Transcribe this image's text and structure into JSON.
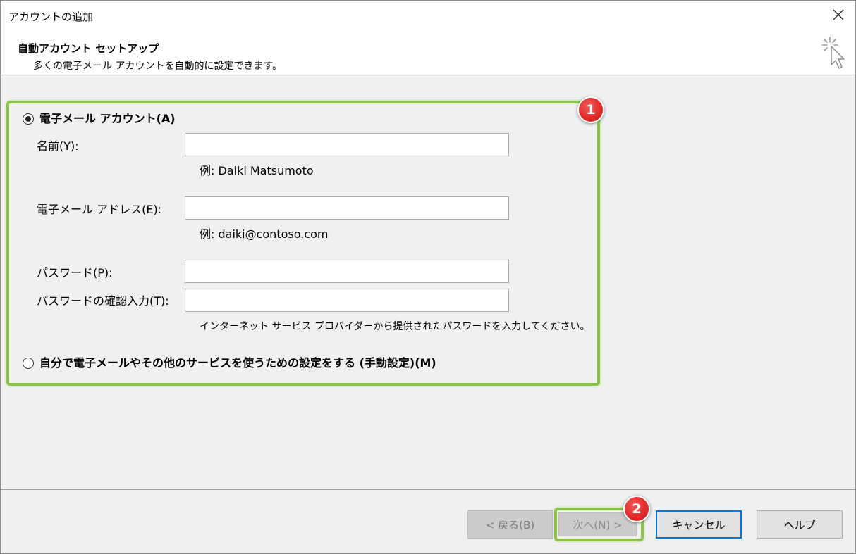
{
  "window": {
    "title": "アカウントの追加",
    "close_icon": "close-icon"
  },
  "header": {
    "title": "自動アカウント セットアップ",
    "subtitle": "多くの電子メール アカウントを自動的に設定できます。",
    "icon": "wizard-cursor-icon"
  },
  "options": {
    "email_account": {
      "label": "電子メール アカウント(A)",
      "checked": true
    },
    "manual_setup": {
      "label": "自分で電子メールやその他のサービスを使うための設定をする (手動設定)(M)",
      "checked": false
    }
  },
  "form": {
    "name": {
      "label": "名前(Y):",
      "value": "",
      "example": "例: Daiki Matsumoto"
    },
    "email": {
      "label": "電子メール アドレス(E):",
      "value": "",
      "example": "例: daiki@contoso.com"
    },
    "password": {
      "label": "パスワード(P):",
      "value": ""
    },
    "password_confirm": {
      "label": "パスワードの確認入力(T):",
      "value": ""
    },
    "password_hint": "インターネット サービス プロバイダーから提供されたパスワードを入力してください。"
  },
  "annotations": {
    "badge1": "1",
    "badge2": "2",
    "highlight_color": "#8bc34a",
    "badge_color": "#e32b2b"
  },
  "buttons": {
    "back": "< 戻る(B)",
    "next": "次へ(N) >",
    "cancel": "キャンセル",
    "help": "ヘルプ"
  },
  "colors": {
    "focus_border": "#0078d7",
    "dialog_bg": "#f0f0f0"
  }
}
